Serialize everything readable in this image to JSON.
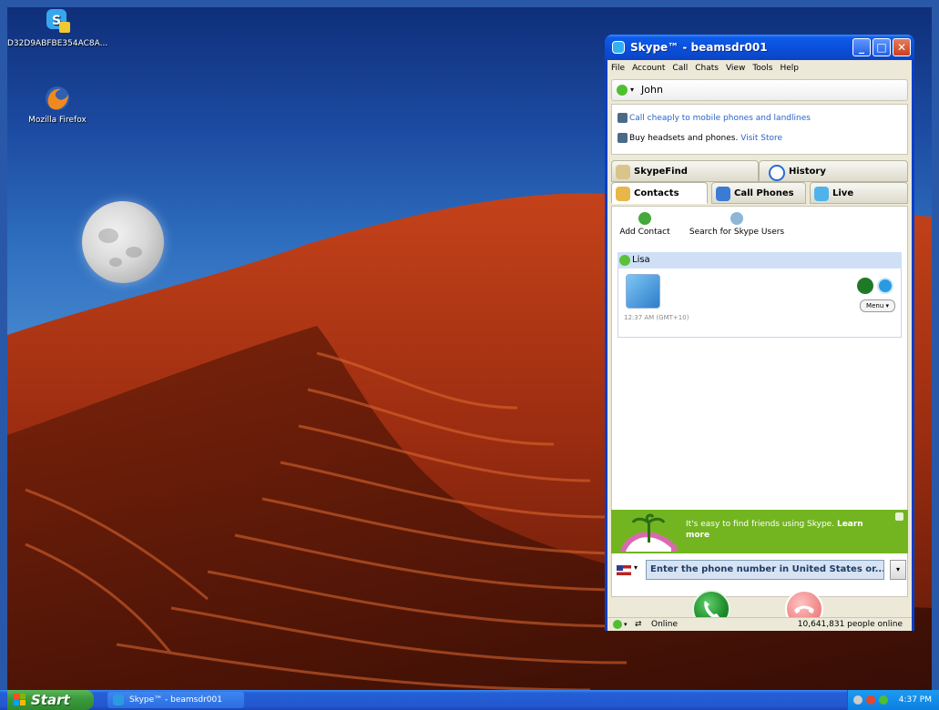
{
  "desktop": {
    "icons": [
      {
        "label": "D32D9ABFBE354AC8A...",
        "icon": "skype-update-icon"
      },
      {
        "label": "Mozilla Firefox",
        "icon": "firefox-icon"
      }
    ]
  },
  "window": {
    "title": "Skype™ - beamsdr001",
    "menu": [
      "File",
      "Account",
      "Call",
      "Chats",
      "View",
      "Tools",
      "Help"
    ],
    "user": "John",
    "promo": {
      "line1": "Call cheaply to mobile phones and landlines",
      "line2_text": "Buy headsets and phones.",
      "line2_link": "Visit Store"
    },
    "tabs": {
      "row1": [
        "SkypeFind",
        "History"
      ],
      "row2": [
        "Contacts",
        "Call Phones",
        "Live"
      ]
    },
    "tools": {
      "add_contact": "Add Contact",
      "search_users": "Search for Skype Users"
    },
    "contact": {
      "name": "Lisa",
      "time": "12:37 AM (GMT+10)",
      "menu": "Menu ▾"
    },
    "banner": {
      "text": "It's easy to find friends using Skype.",
      "link": "Learn more"
    },
    "phone": {
      "placeholder": "Enter the phone number in United States or..."
    },
    "status": {
      "state": "Online",
      "online_count": "10,641,831 people online"
    }
  },
  "taskbar": {
    "start": "Start",
    "task": "Skype™ - beamsdr001",
    "clock": "4:37 PM"
  },
  "colors": {
    "xp_blue": "#0a4ed8",
    "call_green": "#1f8a2a",
    "hangup_red": "#f08a8a",
    "banner_green": "#73b521"
  }
}
